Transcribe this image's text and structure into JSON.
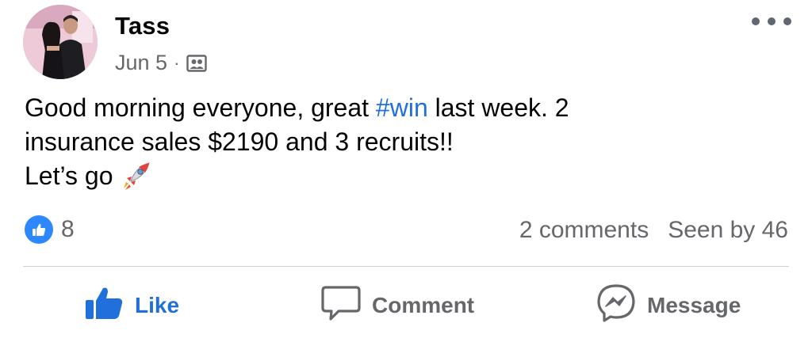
{
  "post": {
    "author_name": "Tass",
    "date": "Jun 5",
    "separator": "·",
    "audience_icon": "friends-list-icon",
    "body": {
      "line1_before": "Good morning everyone, great ",
      "hashtag": "#win",
      "line1_after": " last week.  2",
      "line2": "insurance sales $2190 and 3 recruits!!",
      "line3": "Let’s go"
    },
    "body_emoji": "rocket-icon"
  },
  "stats": {
    "reaction_icon": "like-reaction-icon",
    "reaction_count": "8",
    "comments": "2 comments",
    "seen_by": "Seen by 46"
  },
  "actions": {
    "like": {
      "label": "Like",
      "icon": "thumbs-up-icon",
      "active": true
    },
    "comment": {
      "label": "Comment",
      "icon": "comment-bubble-icon"
    },
    "message": {
      "label": "Message",
      "icon": "messenger-icon"
    }
  },
  "colors": {
    "link_blue": "#216fdb",
    "like_blue": "#2d88ff",
    "secondary_text": "#65676b",
    "primary_text": "#050505",
    "divider": "#ced0d4"
  }
}
